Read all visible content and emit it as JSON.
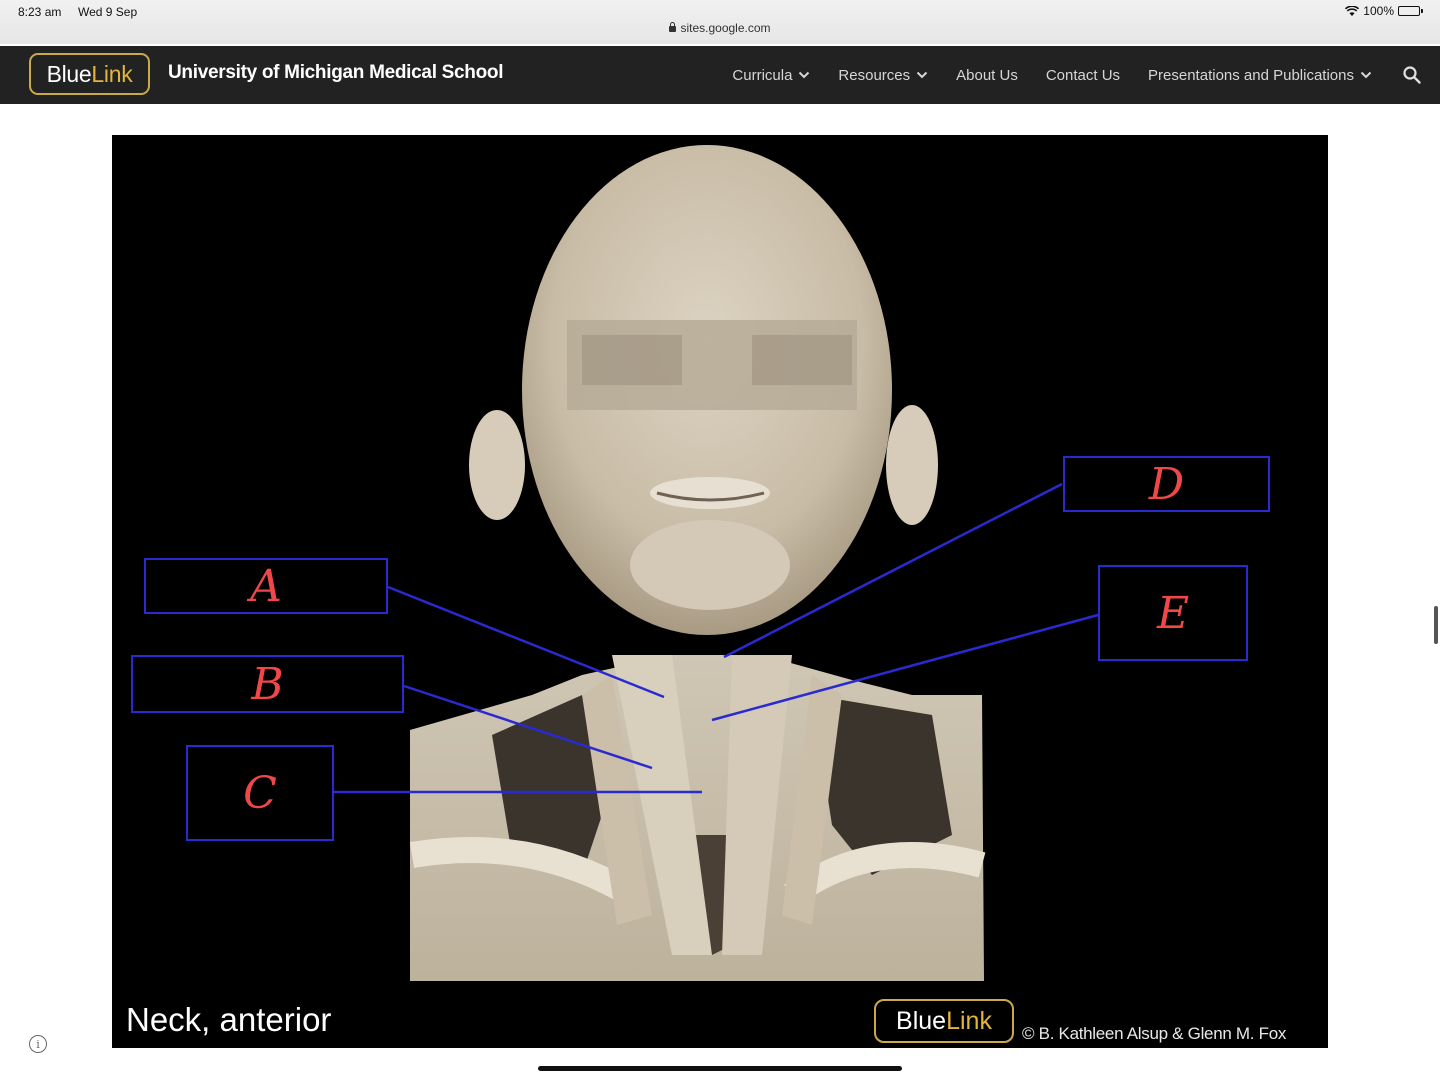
{
  "status_bar": {
    "time": "8:23 am",
    "date": "Wed 9 Sep",
    "url": "sites.google.com",
    "battery": "100%"
  },
  "navbar": {
    "logo_part1": "Blue",
    "logo_part2": "Link",
    "site_title": "University of Michigan Medical School",
    "items": [
      {
        "label": "Curricula",
        "has_dropdown": true
      },
      {
        "label": "Resources",
        "has_dropdown": true
      },
      {
        "label": "About Us",
        "has_dropdown": false
      },
      {
        "label": "Contact Us",
        "has_dropdown": false
      },
      {
        "label": "Presentations and Publications",
        "has_dropdown": true
      }
    ],
    "search_icon": "search-icon"
  },
  "figure": {
    "caption": "Neck, anterior",
    "logo_part1": "Blue",
    "logo_part2": "Link",
    "copyright": "© B. Kathleen Alsup & Glenn M. Fox",
    "labels": [
      "A",
      "B",
      "C",
      "D",
      "E"
    ]
  },
  "colors": {
    "nav_bg": "#222222",
    "logo_gold": "#e2b53c",
    "label_border": "#2a2ad0",
    "label_text": "#f04848",
    "figure_bg": "#000000"
  }
}
